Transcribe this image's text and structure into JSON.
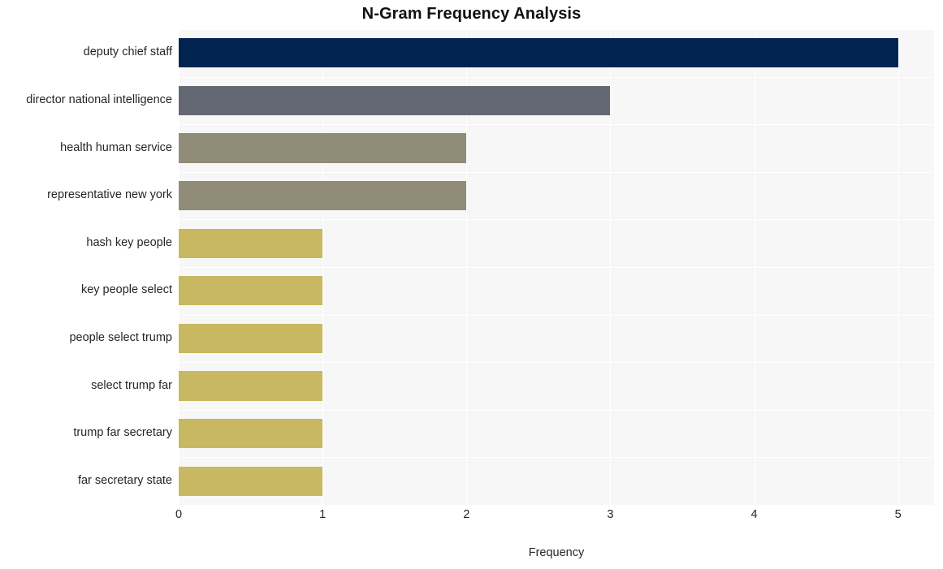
{
  "chart_data": {
    "type": "bar",
    "orientation": "horizontal",
    "title": "N-Gram Frequency Analysis",
    "xlabel": "Frequency",
    "ylabel": "",
    "xlim": [
      0,
      5.25
    ],
    "xticks": [
      "0",
      "1",
      "2",
      "3",
      "4",
      "5"
    ],
    "xtick_values": [
      0,
      1,
      2,
      3,
      4,
      5
    ],
    "grid": true,
    "legend": false,
    "categories": [
      "deputy chief staff",
      "director national intelligence",
      "health human service",
      "representative new york",
      "hash key people",
      "key people select",
      "people select trump",
      "select trump far",
      "trump far secretary",
      "far secretary state"
    ],
    "values": [
      5,
      3,
      2,
      2,
      1,
      1,
      1,
      1,
      1,
      1
    ],
    "bar_colors": [
      "#002350",
      "#646873",
      "#918c77",
      "#918c77",
      "#c8b861",
      "#c8b861",
      "#c8b861",
      "#c8b861",
      "#c8b861",
      "#c8b861"
    ],
    "plot_background": "#f7f7f7",
    "figure_background": "#ffffff",
    "gridline_color": "#ffffff"
  }
}
